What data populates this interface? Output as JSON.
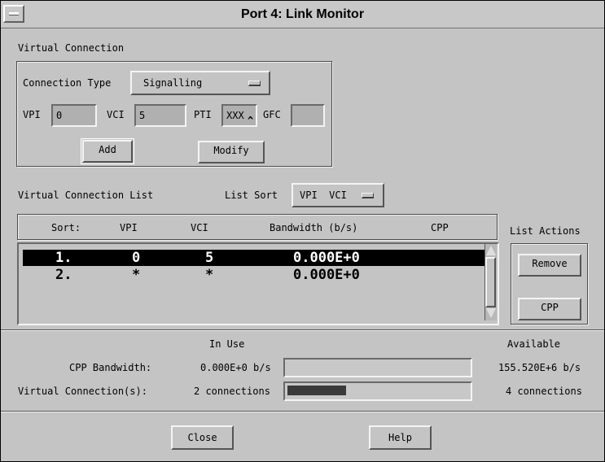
{
  "window": {
    "title": "Port 4: Link Monitor"
  },
  "virtual_connection": {
    "group_label": "Virtual Connection",
    "connection_type_label": "Connection Type",
    "connection_type_value": "Signalling",
    "vpi_label": "VPI",
    "vpi_value": "0",
    "vci_label": "VCI",
    "vci_value": "5",
    "pti_label": "PTI",
    "pti_value": "XXX",
    "gfc_label": "GFC",
    "gfc_value": "",
    "add_label": "Add",
    "modify_label": "Modify"
  },
  "list_header": {
    "title": "Virtual Connection List",
    "sort_label": "List Sort",
    "sort_value": "VPI  VCI"
  },
  "columns": [
    "Sort:",
    "VPI",
    "VCI",
    "Bandwidth (b/s)",
    "CPP"
  ],
  "rows": [
    {
      "sort": "1.",
      "vpi": "0",
      "vci": "5",
      "bandwidth": "0.000E+0",
      "selected": true
    },
    {
      "sort": "2.",
      "vpi": "*",
      "vci": "*",
      "bandwidth": "0.000E+0",
      "selected": false
    }
  ],
  "list_actions": {
    "title": "List Actions",
    "remove_label": "Remove",
    "cpp_label": "CPP"
  },
  "usage": {
    "in_use_label": "In Use",
    "available_label": "Available",
    "cpp_bandwidth_label": "CPP Bandwidth:",
    "cpp_bandwidth_in_use": "0.000E+0 b/s",
    "cpp_bandwidth_available": "155.520E+6 b/s",
    "cpp_bandwidth_fraction": 0.0,
    "vc_label": "Virtual Connection(s):",
    "vc_in_use": "2 connections",
    "vc_available": "4 connections",
    "vc_fraction": 0.33
  },
  "footer": {
    "close_label": "Close",
    "help_label": "Help"
  }
}
